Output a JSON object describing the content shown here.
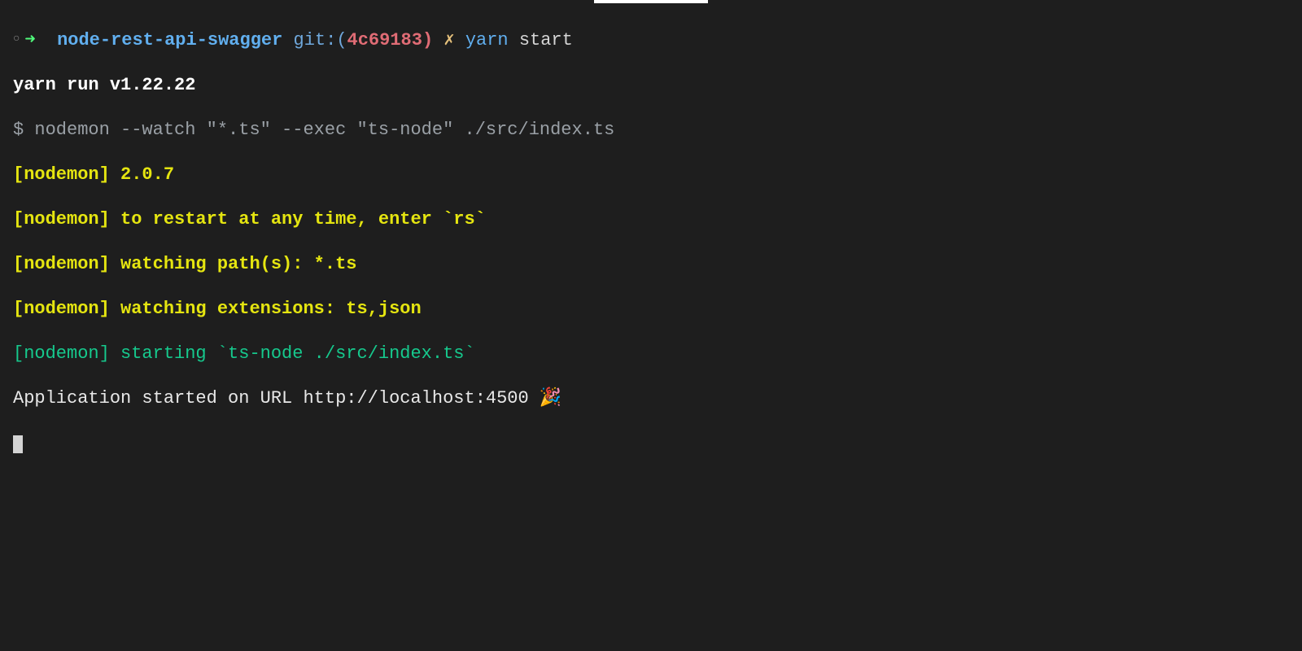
{
  "prompt": {
    "circle": "○",
    "arrow": "➜",
    "dir": "node-rest-api-swagger",
    "git_label": "git:(",
    "git_hash": "4c69183",
    "git_close": ")",
    "dirty": "✗",
    "cmd": "yarn",
    "arg": "start"
  },
  "lines": {
    "yarn_version": "yarn run v1.22.22",
    "spawn": "$ nodemon --watch \"*.ts\" --exec \"ts-node\" ./src/index.ts",
    "nm_version": "[nodemon] 2.0.7",
    "nm_restart": "[nodemon] to restart at any time, enter `rs`",
    "nm_paths": "[nodemon] watching path(s): *.ts",
    "nm_ext": "[nodemon] watching extensions: ts,json",
    "nm_start": "[nodemon] starting `ts-node ./src/index.ts`",
    "app_started": "Application started on URL http://localhost:4500 🎉"
  }
}
